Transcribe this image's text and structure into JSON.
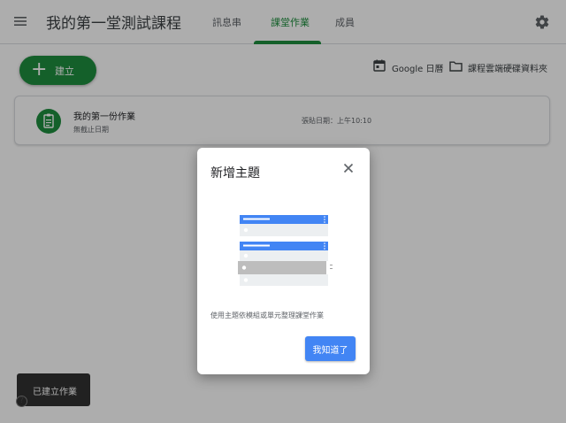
{
  "header": {
    "course_title": "我的第一堂測試課程",
    "tabs": [
      {
        "label": "訊息串"
      },
      {
        "label": "課堂作業"
      },
      {
        "label": "成員"
      }
    ]
  },
  "toolbar": {
    "create_label": "建立",
    "calendar_label": "Google 日曆",
    "folder_label": "課程雲端硬碟資料夾"
  },
  "assignment": {
    "title": "我的第一份作業",
    "due": "無截止日期",
    "posted": "張貼日期：上午10:10"
  },
  "snackbar": {
    "text": "已建立作業"
  },
  "dialog": {
    "title": "新增主題",
    "description": "使用主題依模組或單元整理課堂作業",
    "ok_label": "我知道了"
  },
  "colors": {
    "accent": "#1e8e3e",
    "dialog_button": "#4285f4",
    "illustration_blue": "#4285f4",
    "scrim": "rgba(0,0,0,0.32)"
  }
}
